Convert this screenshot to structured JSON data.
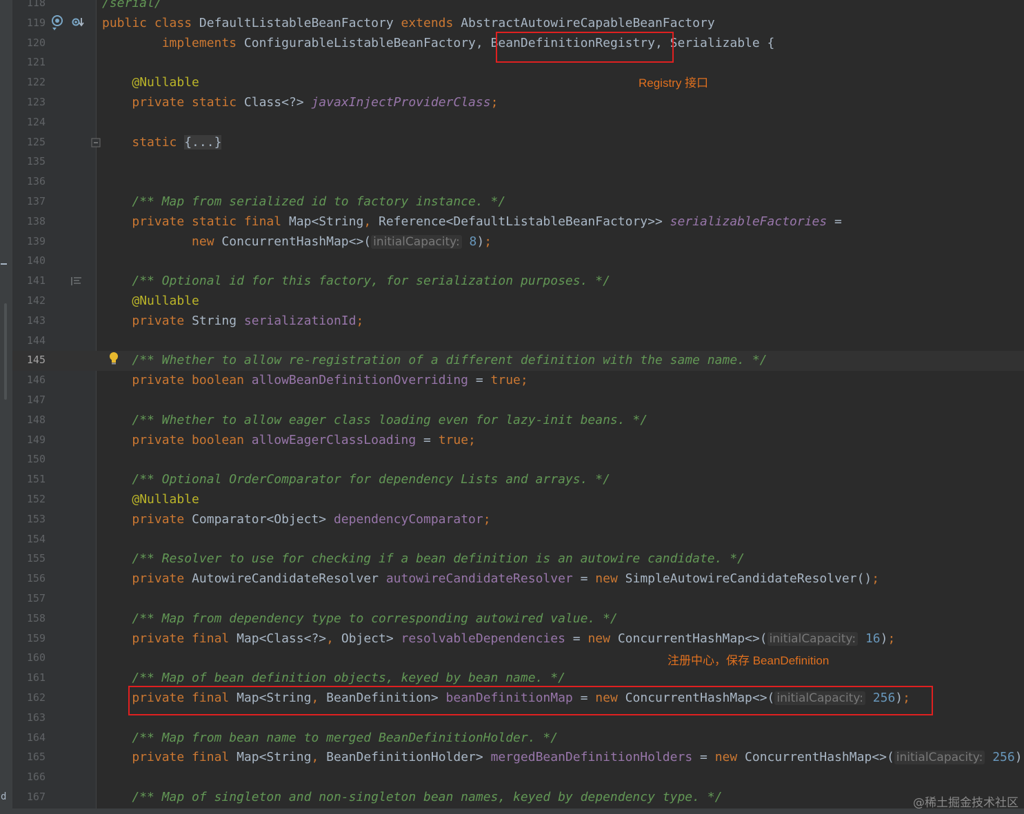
{
  "editor": {
    "lines": [
      {
        "n": "118",
        "tokens": [
          {
            "t": "/serial/",
            "c": "comment"
          }
        ]
      },
      {
        "n": "119",
        "tokens": [
          {
            "t": "public class ",
            "c": "keyword"
          },
          {
            "t": "DefaultListableBeanFactory ",
            "c": "type"
          },
          {
            "t": "extends ",
            "c": "keyword"
          },
          {
            "t": "AbstractAutowireCapableBeanFactory",
            "c": "type"
          }
        ]
      },
      {
        "n": "120",
        "tokens": [
          {
            "t": "        "
          },
          {
            "t": "implements ",
            "c": "keyword"
          },
          {
            "t": "ConfigurableListableBeanFactory",
            "c": "type"
          },
          {
            "t": ", ",
            "c": "punct"
          },
          {
            "t": "BeanDefinitionRegistry",
            "c": "type"
          },
          {
            "t": ", ",
            "c": "punct"
          },
          {
            "t": "Serializable",
            "c": "type"
          },
          {
            "t": " {",
            "c": "punct"
          }
        ]
      },
      {
        "n": "121",
        "tokens": []
      },
      {
        "n": "122",
        "tokens": [
          {
            "t": "    "
          },
          {
            "t": "@Nullable",
            "c": "annotation"
          }
        ]
      },
      {
        "n": "123",
        "tokens": [
          {
            "t": "    "
          },
          {
            "t": "private static ",
            "c": "keyword"
          },
          {
            "t": "Class<?> ",
            "c": "type"
          },
          {
            "t": "javaxInjectProviderClass",
            "c": "fielditalic"
          },
          {
            "t": ";",
            "c": "keyword"
          }
        ]
      },
      {
        "n": "124",
        "tokens": []
      },
      {
        "n": "125",
        "tokens": [
          {
            "t": "    "
          },
          {
            "t": "static ",
            "c": "keyword"
          },
          {
            "t": "{...}",
            "c": "fold"
          }
        ]
      },
      {
        "n": "135",
        "tokens": []
      },
      {
        "n": "136",
        "tokens": []
      },
      {
        "n": "137",
        "tokens": [
          {
            "t": "    "
          },
          {
            "t": "/** Map from serialized id to factory instance. */",
            "c": "comment"
          }
        ]
      },
      {
        "n": "138",
        "tokens": [
          {
            "t": "    "
          },
          {
            "t": "private static final ",
            "c": "keyword"
          },
          {
            "t": "Map<String",
            "c": "type"
          },
          {
            "t": ", ",
            "c": "keyword"
          },
          {
            "t": "Reference<DefaultListableBeanFactory>> ",
            "c": "type"
          },
          {
            "t": "serializableFactories",
            "c": "fielditalic"
          },
          {
            "t": " =",
            "c": "punct"
          }
        ]
      },
      {
        "n": "139",
        "tokens": [
          {
            "t": "            "
          },
          {
            "t": "new ",
            "c": "keyword"
          },
          {
            "t": "ConcurrentHashMap<>(",
            "c": "type"
          },
          {
            "t": "initialCapacity:",
            "c": "hint"
          },
          {
            "t": " "
          },
          {
            "t": "8",
            "c": "number"
          },
          {
            "t": ")",
            "c": "punct"
          },
          {
            "t": ";",
            "c": "keyword"
          }
        ]
      },
      {
        "n": "140",
        "tokens": []
      },
      {
        "n": "141",
        "tokens": [
          {
            "t": "    "
          },
          {
            "t": "/** Optional id for this factory, for serialization purposes. */",
            "c": "comment"
          }
        ]
      },
      {
        "n": "142",
        "tokens": [
          {
            "t": "    "
          },
          {
            "t": "@Nullable",
            "c": "annotation"
          }
        ]
      },
      {
        "n": "143",
        "tokens": [
          {
            "t": "    "
          },
          {
            "t": "private ",
            "c": "keyword"
          },
          {
            "t": "String ",
            "c": "type"
          },
          {
            "t": "serializationId",
            "c": "field"
          },
          {
            "t": ";",
            "c": "keyword"
          }
        ]
      },
      {
        "n": "144",
        "tokens": []
      },
      {
        "n": "145",
        "tokens": [
          {
            "t": "    "
          },
          {
            "t": "/** Whether to allow re-registration of a different definition with the same name. */",
            "c": "comment"
          }
        ]
      },
      {
        "n": "146",
        "tokens": [
          {
            "t": "    "
          },
          {
            "t": "private boolean ",
            "c": "keyword"
          },
          {
            "t": "allowBeanDefinitionOverriding",
            "c": "field"
          },
          {
            "t": " = ",
            "c": "punct"
          },
          {
            "t": "true",
            "c": "keyword"
          },
          {
            "t": ";",
            "c": "keyword"
          }
        ]
      },
      {
        "n": "147",
        "tokens": []
      },
      {
        "n": "148",
        "tokens": [
          {
            "t": "    "
          },
          {
            "t": "/** Whether to allow eager class loading even for lazy-init beans. */",
            "c": "comment"
          }
        ]
      },
      {
        "n": "149",
        "tokens": [
          {
            "t": "    "
          },
          {
            "t": "private boolean ",
            "c": "keyword"
          },
          {
            "t": "allowEagerClassLoading",
            "c": "field"
          },
          {
            "t": " = ",
            "c": "punct"
          },
          {
            "t": "true",
            "c": "keyword"
          },
          {
            "t": ";",
            "c": "keyword"
          }
        ]
      },
      {
        "n": "150",
        "tokens": []
      },
      {
        "n": "151",
        "tokens": [
          {
            "t": "    "
          },
          {
            "t": "/** Optional OrderComparator for dependency Lists and arrays. */",
            "c": "comment"
          }
        ]
      },
      {
        "n": "152",
        "tokens": [
          {
            "t": "    "
          },
          {
            "t": "@Nullable",
            "c": "annotation"
          }
        ]
      },
      {
        "n": "153",
        "tokens": [
          {
            "t": "    "
          },
          {
            "t": "private ",
            "c": "keyword"
          },
          {
            "t": "Comparator<Object> ",
            "c": "type"
          },
          {
            "t": "dependencyComparator",
            "c": "field"
          },
          {
            "t": ";",
            "c": "keyword"
          }
        ]
      },
      {
        "n": "154",
        "tokens": []
      },
      {
        "n": "155",
        "tokens": [
          {
            "t": "    "
          },
          {
            "t": "/** Resolver to use for checking if a bean definition is an autowire candidate. */",
            "c": "comment"
          }
        ]
      },
      {
        "n": "156",
        "tokens": [
          {
            "t": "    "
          },
          {
            "t": "private ",
            "c": "keyword"
          },
          {
            "t": "AutowireCandidateResolver ",
            "c": "type"
          },
          {
            "t": "autowireCandidateResolver",
            "c": "field"
          },
          {
            "t": " = ",
            "c": "punct"
          },
          {
            "t": "new ",
            "c": "keyword"
          },
          {
            "t": "SimpleAutowireCandidateResolver()",
            "c": "type"
          },
          {
            "t": ";",
            "c": "keyword"
          }
        ]
      },
      {
        "n": "157",
        "tokens": []
      },
      {
        "n": "158",
        "tokens": [
          {
            "t": "    "
          },
          {
            "t": "/** Map from dependency type to corresponding autowired value. */",
            "c": "comment"
          }
        ]
      },
      {
        "n": "159",
        "tokens": [
          {
            "t": "    "
          },
          {
            "t": "private final ",
            "c": "keyword"
          },
          {
            "t": "Map<Class<?>",
            "c": "type"
          },
          {
            "t": ", ",
            "c": "keyword"
          },
          {
            "t": "Object> ",
            "c": "type"
          },
          {
            "t": "resolvableDependencies",
            "c": "field"
          },
          {
            "t": " = ",
            "c": "punct"
          },
          {
            "t": "new ",
            "c": "keyword"
          },
          {
            "t": "ConcurrentHashMap<>(",
            "c": "type"
          },
          {
            "t": "initialCapacity:",
            "c": "hint"
          },
          {
            "t": " "
          },
          {
            "t": "16",
            "c": "number"
          },
          {
            "t": ")",
            "c": "punct"
          },
          {
            "t": ";",
            "c": "keyword"
          }
        ]
      },
      {
        "n": "160",
        "tokens": []
      },
      {
        "n": "161",
        "tokens": [
          {
            "t": "    "
          },
          {
            "t": "/** Map of bean definition objects, keyed by bean name. */",
            "c": "comment"
          }
        ]
      },
      {
        "n": "162",
        "tokens": [
          {
            "t": "    "
          },
          {
            "t": "private final ",
            "c": "keyword"
          },
          {
            "t": "Map<String",
            "c": "type"
          },
          {
            "t": ", ",
            "c": "keyword"
          },
          {
            "t": "BeanDefinition> ",
            "c": "type"
          },
          {
            "t": "beanDefinitionMap",
            "c": "field"
          },
          {
            "t": " = ",
            "c": "punct"
          },
          {
            "t": "new ",
            "c": "keyword"
          },
          {
            "t": "ConcurrentHashMap<>(",
            "c": "type"
          },
          {
            "t": "initialCapacity:",
            "c": "hint"
          },
          {
            "t": " "
          },
          {
            "t": "256",
            "c": "number"
          },
          {
            "t": ")",
            "c": "punct"
          },
          {
            "t": ";",
            "c": "keyword"
          }
        ]
      },
      {
        "n": "163",
        "tokens": []
      },
      {
        "n": "164",
        "tokens": [
          {
            "t": "    "
          },
          {
            "t": "/** Map from bean name to merged BeanDefinitionHolder. */",
            "c": "comment"
          }
        ]
      },
      {
        "n": "165",
        "tokens": [
          {
            "t": "    "
          },
          {
            "t": "private final ",
            "c": "keyword"
          },
          {
            "t": "Map<String",
            "c": "type"
          },
          {
            "t": ", ",
            "c": "keyword"
          },
          {
            "t": "BeanDefinitionHolder> ",
            "c": "type"
          },
          {
            "t": "mergedBeanDefinitionHolders",
            "c": "field"
          },
          {
            "t": " = ",
            "c": "punct"
          },
          {
            "t": "new ",
            "c": "keyword"
          },
          {
            "t": "ConcurrentHashMap<>(",
            "c": "type"
          },
          {
            "t": "initialCapacity:",
            "c": "hint"
          },
          {
            "t": " "
          },
          {
            "t": "256",
            "c": "number"
          },
          {
            "t": ")",
            "c": "punct"
          },
          {
            "t": ";",
            "c": "keyword"
          }
        ]
      },
      {
        "n": "166",
        "tokens": []
      },
      {
        "n": "167",
        "tokens": [
          {
            "t": "    "
          },
          {
            "t": "/** Map of singleton and non-singleton bean names, keyed by dependency type. */",
            "c": "comment"
          }
        ]
      }
    ],
    "current_line": "145",
    "gutter_icons": {
      "line_119": [
        "implementations-marker-icon",
        "subclasses-marker-icon"
      ],
      "line_125": "fold-expand-icon",
      "line_141": "structure-marker-icon",
      "line_145": "lightbulb-icon"
    }
  },
  "annotations": {
    "registry_note": "Registry 接口",
    "registration_center_note": "注册中心，保存 BeanDefinition"
  },
  "watermark": "@稀土掘金技术社区",
  "colors": {
    "background": "#2b2b2b",
    "gutter": "#313335",
    "keyword": "#cc7832",
    "field": "#9876aa",
    "comment": "#629755",
    "number": "#6897bb",
    "annotation": "#bbb529",
    "highlight_box": "#e02020",
    "note_text": "#e0701f"
  }
}
